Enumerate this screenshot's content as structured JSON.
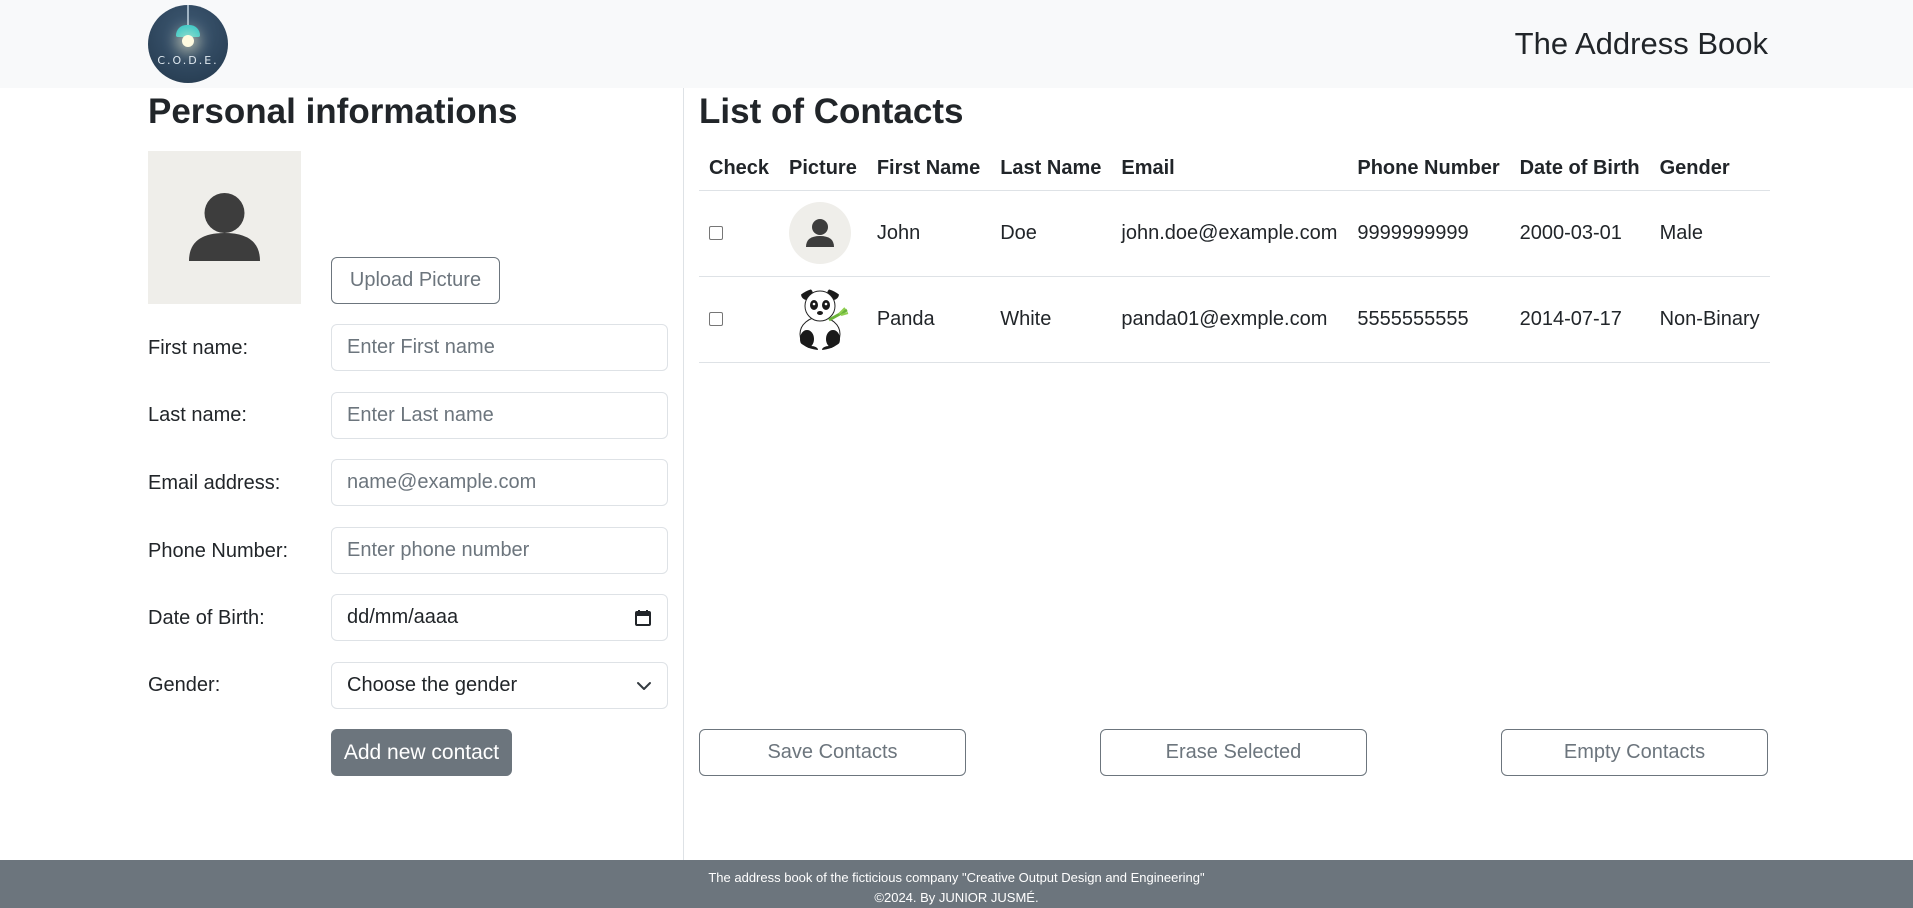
{
  "header": {
    "logo_text": "C.O.D.E.",
    "title": "The Address Book"
  },
  "form": {
    "title": "Personal informations",
    "upload_label": "Upload Picture",
    "fields": {
      "first_name": {
        "label": "First name:",
        "placeholder": "Enter First name"
      },
      "last_name": {
        "label": "Last name:",
        "placeholder": "Enter Last name"
      },
      "email": {
        "label": "Email address:",
        "placeholder": "name@example.com"
      },
      "phone": {
        "label": "Phone Number:",
        "placeholder": "Enter phone number"
      },
      "dob": {
        "label": "Date of Birth:",
        "value": "dd/mm/aaaa"
      },
      "gender": {
        "label": "Gender:",
        "value": "Choose the gender"
      }
    },
    "submit_label": "Add new contact"
  },
  "contacts": {
    "title": "List of Contacts",
    "columns": [
      "Check",
      "Picture",
      "First Name",
      "Last Name",
      "Email",
      "Phone Number",
      "Date of Birth",
      "Gender"
    ],
    "rows": [
      {
        "picture": "person-silhouette-icon",
        "first_name": "John",
        "last_name": "Doe",
        "email": "john.doe@example.com",
        "phone": "9999999999",
        "dob": "2000-03-01",
        "gender": "Male"
      },
      {
        "picture": "panda-image",
        "first_name": "Panda",
        "last_name": "White",
        "email": "panda01@exmple.com",
        "phone": "5555555555",
        "dob": "2014-07-17",
        "gender": "Non-Binary"
      }
    ],
    "actions": {
      "save": "Save Contacts",
      "erase": "Erase Selected",
      "empty": "Empty Contacts"
    }
  },
  "footer": {
    "line1": "The address book of the ficticious company \"Creative Output Design and Engineering\"",
    "line2": "©2024. By JUNIOR JUSMÉ."
  },
  "colors": {
    "navbar_bg": "#f8f9fa",
    "secondary": "#6c757d",
    "avatar_bg": "#efeeea",
    "border": "#dee2e6",
    "logo_bg": "#2b4258",
    "lamp": "#2ec4c6"
  }
}
